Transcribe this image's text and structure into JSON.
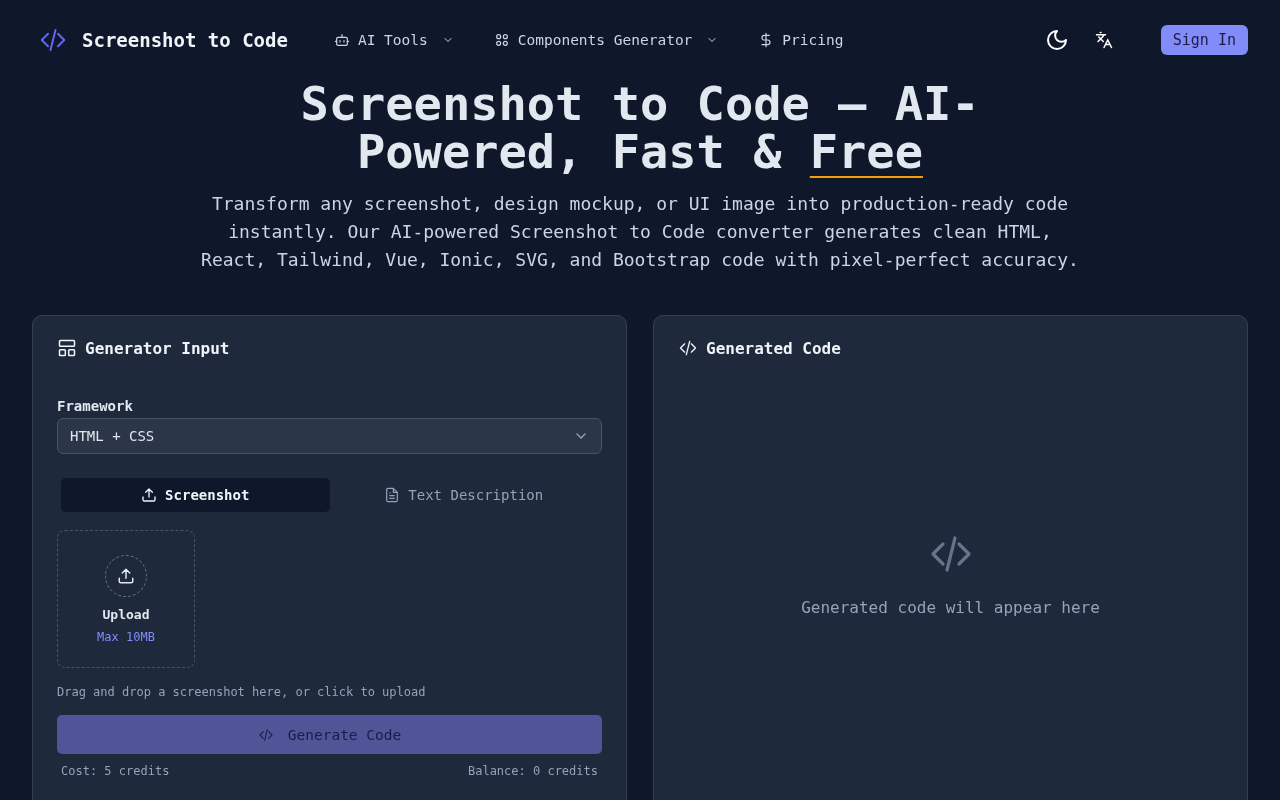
{
  "header": {
    "logo": "Screenshot to Code",
    "nav": [
      {
        "label": "AI Tools",
        "kind": "robot",
        "dropdown": true
      },
      {
        "label": "Components Generator",
        "kind": "grid",
        "dropdown": true
      },
      {
        "label": "Pricing",
        "kind": "dollar",
        "dropdown": false
      }
    ],
    "sign_in": "Sign In"
  },
  "hero": {
    "title": "Screenshot to Code — AI-Powered, Fast & ",
    "title_highlight": "Free",
    "subtitle": "Transform any screenshot, design mockup, or UI image into production-ready code instantly. Our AI-powered Screenshot to Code converter generates clean HTML, React, Tailwind, Vue, Ionic, SVG, and Bootstrap code with pixel-perfect accuracy."
  },
  "input_panel": {
    "title": "Generator Input",
    "framework_label": "Framework",
    "framework_value": "HTML + CSS",
    "tabs": [
      {
        "label": "Screenshot",
        "kind": "upload",
        "selected": true
      },
      {
        "label": "Text Description",
        "kind": "file",
        "selected": false
      }
    ],
    "upload": {
      "label": "Upload",
      "limit": "Max 10MB"
    },
    "hint": "Drag and drop a screenshot here, or click to upload",
    "generate": {
      "label": "Generate Code",
      "disabled": true
    },
    "cost": "Cost: 5 credits",
    "balance": "Balance: 0 credits"
  },
  "output_panel": {
    "title": "Generated Code",
    "empty_text": "Generated code will appear here"
  }
}
